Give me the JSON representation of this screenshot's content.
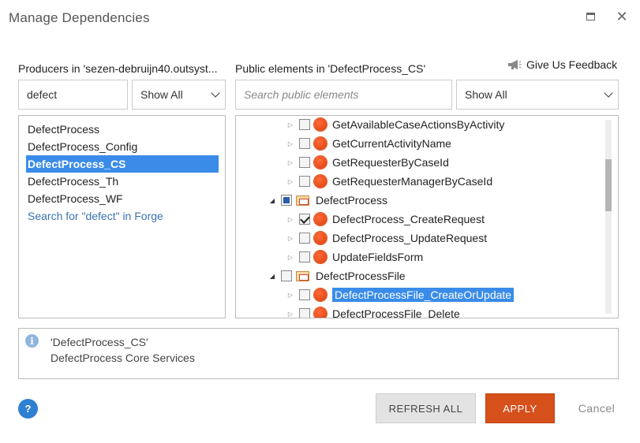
{
  "dialog": {
    "title": "Manage Dependencies"
  },
  "producers": {
    "label": "Producers in 'sezen-debruijn40.outsyst...",
    "search_value": "defect",
    "filter_value": "Show All",
    "items": [
      {
        "label": "DefectProcess",
        "selected": false
      },
      {
        "label": "DefectProcess_Config",
        "selected": false
      },
      {
        "label": "DefectProcess_CS",
        "selected": true
      },
      {
        "label": "DefectProcess_Th",
        "selected": false
      },
      {
        "label": "DefectProcess_WF",
        "selected": false
      }
    ],
    "forge_link": "Search for \"defect\" in Forge"
  },
  "public_elements": {
    "label": "Public elements in 'DefectProcess_CS'",
    "search_placeholder": "Search public elements",
    "filter_value": "Show All",
    "feedback_label": "Give Us Feedback",
    "tree": [
      {
        "label": "GetAvailableCaseActionsByActivity",
        "type": "action",
        "checked": false
      },
      {
        "label": "GetCurrentActivityName",
        "type": "action",
        "checked": false
      },
      {
        "label": "GetRequesterByCaseId",
        "type": "action",
        "checked": false
      },
      {
        "label": "GetRequesterManagerByCaseId",
        "type": "action",
        "checked": false
      },
      {
        "label": "DefectProcess",
        "type": "folder",
        "checked": "partial",
        "expanded": true
      },
      {
        "label": "DefectProcess_CreateRequest",
        "type": "action",
        "checked": true
      },
      {
        "label": "DefectProcess_UpdateRequest",
        "type": "action",
        "checked": false
      },
      {
        "label": "UpdateFieldsForm",
        "type": "action",
        "checked": false
      },
      {
        "label": "DefectProcessFile",
        "type": "folder",
        "checked": false,
        "expanded": true
      },
      {
        "label": "DefectProcessFile_CreateOrUpdate",
        "type": "action",
        "checked": false,
        "selected": true
      },
      {
        "label": "DefectProcessFile_Delete",
        "type": "action",
        "checked": false
      }
    ]
  },
  "info": {
    "module_name": "'DefectProcess_CS'",
    "description": "DefectProcess Core Services"
  },
  "footer": {
    "help_label": "?",
    "refresh_label": "REFRESH ALL",
    "apply_label": "APPLY",
    "cancel_label": "Cancel"
  },
  "colors": {
    "accent": "#3a8ce8",
    "apply": "#d6501c",
    "link": "#3b73b3"
  }
}
